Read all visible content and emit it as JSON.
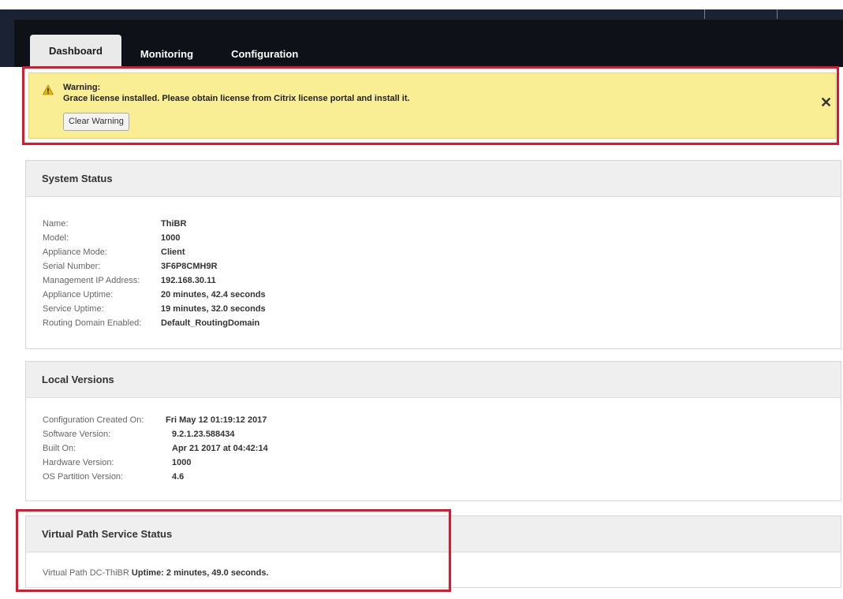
{
  "tabs": [
    {
      "label": "Dashboard",
      "active": true
    },
    {
      "label": "Monitoring",
      "active": false
    },
    {
      "label": "Configuration",
      "active": false
    }
  ],
  "warning": {
    "title": "Warning:",
    "message": "Grace license installed. Please obtain license from Citrix license portal and install it.",
    "button": "Clear Warning",
    "close": "✕"
  },
  "system_status": {
    "title": "System Status",
    "rows": [
      {
        "label": "Name:",
        "value": "ThiBR"
      },
      {
        "label": "Model:",
        "value": "1000"
      },
      {
        "label": "Appliance Mode:",
        "value": "Client"
      },
      {
        "label": "Serial Number:",
        "value": "3F6P8CMH9R"
      },
      {
        "label": "Management IP Address:",
        "value": "192.168.30.11"
      },
      {
        "label": "Appliance Uptime:",
        "value": "20 minutes, 42.4 seconds"
      },
      {
        "label": "Service Uptime:",
        "value": "19 minutes, 32.0 seconds"
      },
      {
        "label": "Routing Domain Enabled:",
        "value": "Default_RoutingDomain"
      }
    ]
  },
  "local_versions": {
    "title": "Local Versions",
    "rows": [
      {
        "label": "Configuration Created On:",
        "value": "Fri May 12 01:19:12 2017"
      },
      {
        "label": "Software Version:",
        "value": "9.2.1.23.588434"
      },
      {
        "label": "Built On:",
        "value": "Apr 21 2017 at 04:42:14"
      },
      {
        "label": "Hardware Version:",
        "value": "1000"
      },
      {
        "label": "OS Partition Version:",
        "value": "4.6"
      }
    ]
  },
  "virtual_path": {
    "title": "Virtual Path Service Status",
    "label": "Virtual Path DC-ThiBR",
    "value": "Uptime: 2 minutes, 49.0 seconds."
  },
  "colors": {
    "header_bg": "#0e1118",
    "warning_bg": "#faee95",
    "highlight_border": "#e0162b"
  }
}
